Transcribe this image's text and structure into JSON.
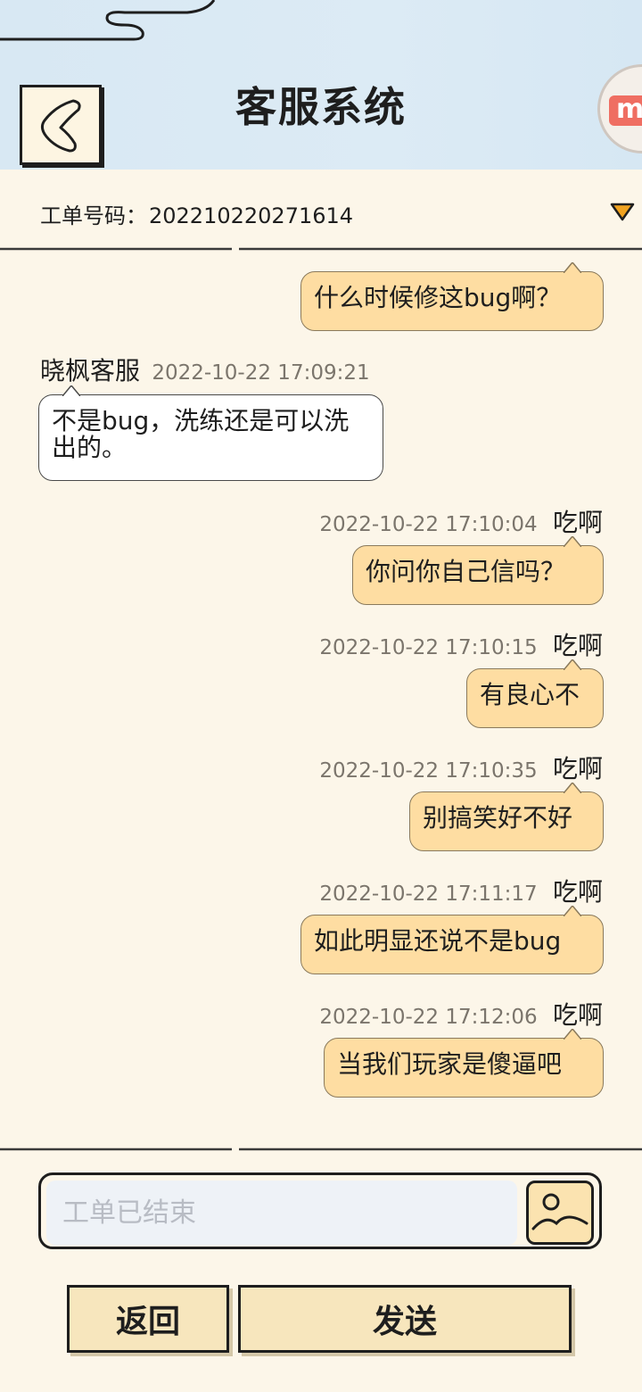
{
  "header": {
    "title": "客服系统",
    "back_icon": "back-arrow-icon",
    "badge_letter": "m"
  },
  "ticket": {
    "label": "工单号码：",
    "number": "202210220271614",
    "dropdown_icon": "triangle-down-icon"
  },
  "messages": [
    {
      "side": "right",
      "text": "什么时候修这bug啊？"
    },
    {
      "side": "left",
      "name": "晓枫客服",
      "time": "2022-10-22 17:09:21",
      "text": "不是bug，洗练还是可以洗出的。"
    },
    {
      "side": "right",
      "name": "吃啊",
      "time": "2022-10-22 17:10:04",
      "text": "你问你自己信吗？"
    },
    {
      "side": "right",
      "name": "吃啊",
      "time": "2022-10-22 17:10:15",
      "text": "有良心不"
    },
    {
      "side": "right",
      "name": "吃啊",
      "time": "2022-10-22 17:10:35",
      "text": "别搞笑好不好"
    },
    {
      "side": "right",
      "name": "吃啊",
      "time": "2022-10-22 17:11:17",
      "text": "如此明显还说不是bug"
    },
    {
      "side": "right",
      "name": "吃啊",
      "time": "2022-10-22 17:12:06",
      "text": "当我们玩家是傻逼吧"
    }
  ],
  "input": {
    "placeholder": "工单已结束",
    "image_icon": "image-icon"
  },
  "buttons": {
    "back_label": "返回",
    "send_label": "发送"
  },
  "colors": {
    "background": "#fcf6e9",
    "header_bg": "#d8e8f3",
    "bubble_right": "#fedda2",
    "bubble_left": "#ffffff",
    "button_bg": "#f7e6bd"
  }
}
